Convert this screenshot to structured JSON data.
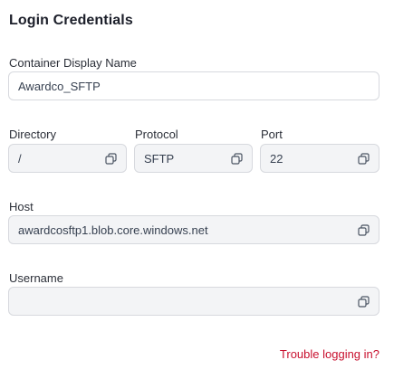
{
  "section": {
    "title": "Login Credentials"
  },
  "fields": {
    "container_display_name": {
      "label": "Container Display Name",
      "value": "Awardco_SFTP"
    },
    "directory": {
      "label": "Directory",
      "value": "/"
    },
    "protocol": {
      "label": "Protocol",
      "value": "SFTP"
    },
    "port": {
      "label": "Port",
      "value": "22"
    },
    "host": {
      "label": "Host",
      "value": "awardcosftp1.blob.core.windows.net"
    },
    "username": {
      "label": "Username",
      "value": ""
    }
  },
  "links": {
    "trouble": "Trouble logging in?"
  },
  "icons": {
    "copy": "copy-icon"
  },
  "colors": {
    "link": "#c8102e",
    "readonly_field_bg": "#f3f4f6",
    "field_border": "#d7d9de"
  }
}
